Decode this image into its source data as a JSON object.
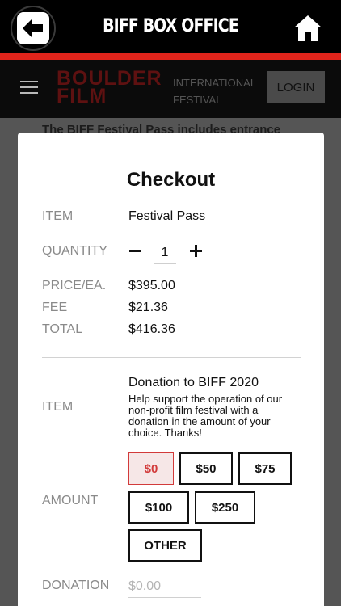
{
  "app_bar": {
    "title": "BIFF BOX OFFICE",
    "back_icon": "arrow-left-icon",
    "home_icon": "home-icon"
  },
  "site_header": {
    "logo_main": "BOULDER FILM",
    "logo_sub": "INTERNATIONAL FESTIVAL",
    "login_label": "LOGIN",
    "body_text": "The BIFF Festival Pass includes entrance"
  },
  "checkout": {
    "title": "Checkout",
    "item_label": "ITEM",
    "item_value": "Festival Pass",
    "quantity_label": "QUANTITY",
    "quantity_value": "1",
    "price_label": "PRICE/EA.",
    "price_value": "$395.00",
    "fee_label": "FEE",
    "fee_value": "$21.36",
    "total_label": "TOTAL",
    "total_value": "$416.36",
    "donation_item_label": "ITEM",
    "donation_title": "Donation to BIFF 2020",
    "donation_desc": "Help support the operation of our non-profit film festival with a donation in the amount of your choice. Thanks!",
    "amount_label": "AMOUNT",
    "amounts": [
      "$0",
      "$50",
      "$75",
      "$100",
      "$250",
      "OTHER"
    ],
    "selected_amount": "$0",
    "donation_label": "DONATION",
    "donation_placeholder": "$0.00"
  },
  "colors": {
    "accent_red": "#e0241b",
    "selected_red": "#d23a3a"
  }
}
